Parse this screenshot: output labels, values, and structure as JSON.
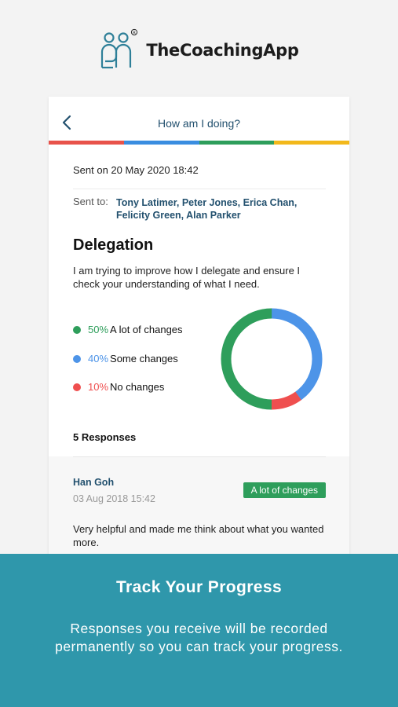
{
  "brand": {
    "name": "TheCoachingApp",
    "logo_icon": "coaching-people-logo"
  },
  "header": {
    "title": "How am I doing?",
    "back_icon": "chevron-left-icon"
  },
  "color_bar": [
    "#e8534b",
    "#3a8de0",
    "#2e9e5b",
    "#f2b81b"
  ],
  "sent_on": "Sent on 20 May 2020 18:42",
  "sent_to": {
    "label": "Sent to:",
    "names": "Tony Latimer, Peter Jones, Erica Chan, Felicity Green, Alan Parker"
  },
  "topic": {
    "title": "Delegation",
    "description": "I am trying to improve how I delegate and ensure I check your understanding of what I need."
  },
  "results": [
    {
      "pct": "50%",
      "label": "A lot of changes",
      "color": "#2e9e5b"
    },
    {
      "pct": "40%",
      "label": "Some changes",
      "color": "#4d94e8"
    },
    {
      "pct": "10%",
      "label": "No changes",
      "color": "#ef4f4f"
    }
  ],
  "responses": {
    "count_label": "5 Responses",
    "items": [
      {
        "name": "Han Goh",
        "date": "03 Aug 2018 15:42",
        "badge": "A lot of changes",
        "text": "Very helpful and made me think about what you wanted more."
      }
    ]
  },
  "promo": {
    "title": "Track Your Progress",
    "text": "Responses you receive will be recorded permanently so you can track your progress."
  }
}
